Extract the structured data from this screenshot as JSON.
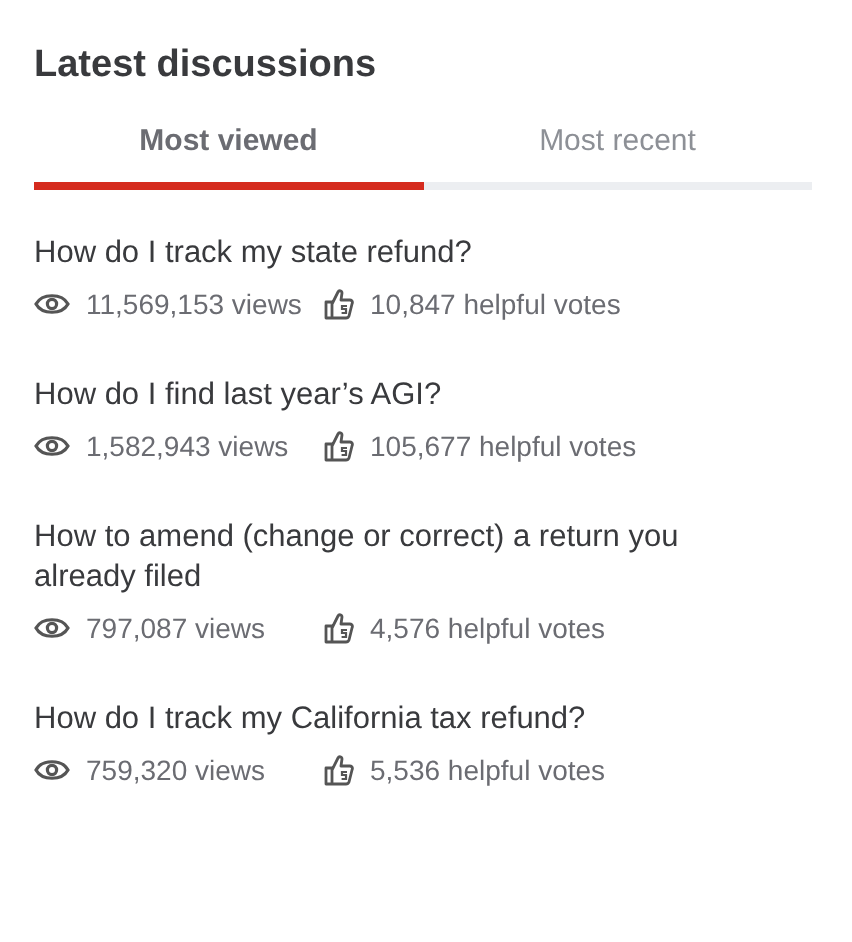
{
  "heading": "Latest discussions",
  "tabs": [
    {
      "label": "Most viewed",
      "selected": true
    },
    {
      "label": "Most recent",
      "selected": false
    }
  ],
  "discussions": [
    {
      "title": "How do I track my state refund?",
      "views": "11,569,153 views",
      "votes": "10,847 helpful votes"
    },
    {
      "title": "How do I find last year’s AGI?",
      "views": "1,582,943 views",
      "votes": "105,677 helpful votes"
    },
    {
      "title": "How to amend (change or correct) a return you already filed",
      "views": "797,087 views",
      "votes": "4,576 helpful votes"
    },
    {
      "title": "How do I track my California tax refund?",
      "views": "759,320 views",
      "votes": "5,536 helpful votes"
    }
  ]
}
